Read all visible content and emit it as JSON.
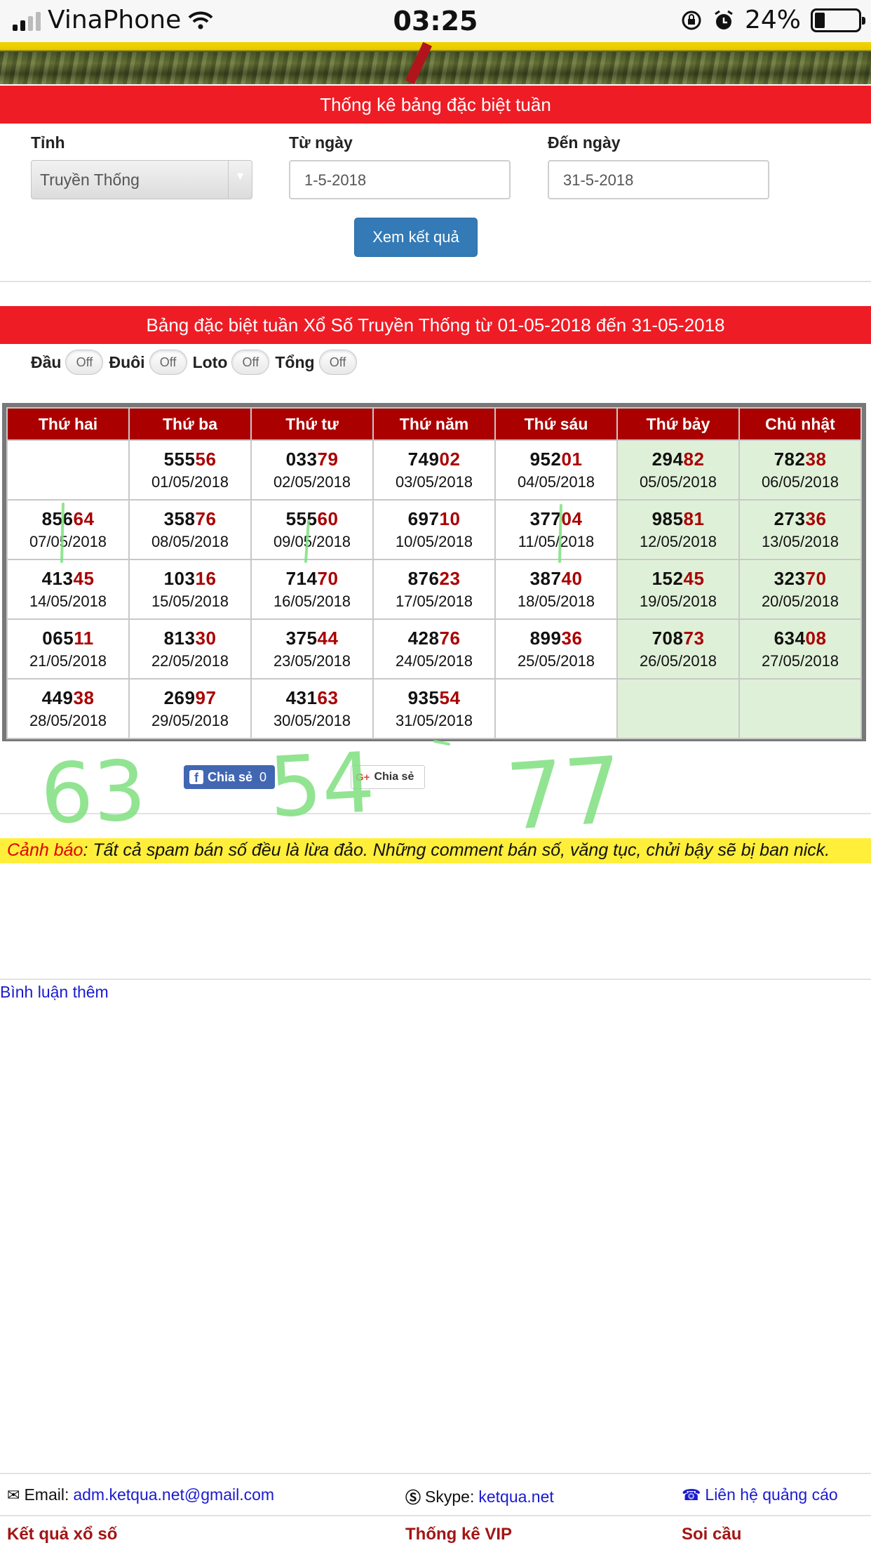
{
  "status_bar": {
    "carrier": "VinaPhone",
    "time": "03:25",
    "battery": "24%",
    "battery_level": 0.24
  },
  "stats_form": {
    "title": "Thống kê bảng đặc biệt tuần",
    "province_label": "Tỉnh",
    "province_value": "Truyền Thống",
    "from_label": "Từ ngày",
    "from_value": "1-5-2018",
    "to_label": "Đến ngày",
    "to_value": "31-5-2018",
    "submit_label": "Xem kết quả"
  },
  "results": {
    "title": "Bảng đặc biệt tuần Xổ Số Truyền Thống từ 01-05-2018 đến 31-05-2018",
    "toggles": [
      {
        "label": "Đầu",
        "state": "Off"
      },
      {
        "label": "Đuôi",
        "state": "Off"
      },
      {
        "label": "Loto",
        "state": "Off"
      },
      {
        "label": "Tổng",
        "state": "Off"
      }
    ],
    "columns": [
      "Thứ hai",
      "Thứ ba",
      "Thứ tư",
      "Thứ năm",
      "Thứ sáu",
      "Thứ bảy",
      "Chủ nhật"
    ],
    "rows": [
      [
        null,
        {
          "head": "555",
          "tail": "56",
          "date": "01/05/2018"
        },
        {
          "head": "033",
          "tail": "79",
          "date": "02/05/2018"
        },
        {
          "head": "749",
          "tail": "02",
          "date": "03/05/2018"
        },
        {
          "head": "952",
          "tail": "01",
          "date": "04/05/2018"
        },
        {
          "head": "294",
          "tail": "82",
          "date": "05/05/2018"
        },
        {
          "head": "782",
          "tail": "38",
          "date": "06/05/2018"
        }
      ],
      [
        {
          "head": "856",
          "tail": "64",
          "date": "07/05/2018"
        },
        {
          "head": "358",
          "tail": "76",
          "date": "08/05/2018"
        },
        {
          "head": "555",
          "tail": "60",
          "date": "09/05/2018"
        },
        {
          "head": "697",
          "tail": "10",
          "date": "10/05/2018"
        },
        {
          "head": "377",
          "tail": "04",
          "date": "11/05/2018"
        },
        {
          "head": "985",
          "tail": "81",
          "date": "12/05/2018"
        },
        {
          "head": "273",
          "tail": "36",
          "date": "13/05/2018"
        }
      ],
      [
        {
          "head": "413",
          "tail": "45",
          "date": "14/05/2018"
        },
        {
          "head": "103",
          "tail": "16",
          "date": "15/05/2018"
        },
        {
          "head": "714",
          "tail": "70",
          "date": "16/05/2018"
        },
        {
          "head": "876",
          "tail": "23",
          "date": "17/05/2018"
        },
        {
          "head": "387",
          "tail": "40",
          "date": "18/05/2018"
        },
        {
          "head": "152",
          "tail": "45",
          "date": "19/05/2018"
        },
        {
          "head": "323",
          "tail": "70",
          "date": "20/05/2018"
        }
      ],
      [
        {
          "head": "065",
          "tail": "11",
          "date": "21/05/2018"
        },
        {
          "head": "813",
          "tail": "30",
          "date": "22/05/2018"
        },
        {
          "head": "375",
          "tail": "44",
          "date": "23/05/2018"
        },
        {
          "head": "428",
          "tail": "76",
          "date": "24/05/2018"
        },
        {
          "head": "899",
          "tail": "36",
          "date": "25/05/2018"
        },
        {
          "head": "708",
          "tail": "73",
          "date": "26/05/2018"
        },
        {
          "head": "634",
          "tail": "08",
          "date": "27/05/2018"
        }
      ],
      [
        {
          "head": "449",
          "tail": "38",
          "date": "28/05/2018"
        },
        {
          "head": "269",
          "tail": "97",
          "date": "29/05/2018"
        },
        {
          "head": "431",
          "tail": "63",
          "date": "30/05/2018"
        },
        {
          "head": "935",
          "tail": "54",
          "date": "31/05/2018"
        },
        null,
        null,
        null
      ]
    ]
  },
  "share": {
    "facebook_label": "Chia sẻ",
    "facebook_count": "0",
    "google_label": "Chia sẻ"
  },
  "warning": {
    "prefix": "Cảnh báo",
    "text": ": Tất cả spam bán số đều là lừa đảo. Những comment bán số, văng tục, chửi bậy sẽ bị ban nick."
  },
  "comments": {
    "more_label": "Bình luận thêm"
  },
  "footer": {
    "email_label": "Email:",
    "email_value": "adm.ketqua.net@gmail.com",
    "skype_label": "Skype:",
    "skype_value": "ketqua.net",
    "ads_label": "Liên hệ quảng cáo",
    "nav": [
      "Kết quả xổ số",
      "Thống kê VIP",
      "Soi cầu"
    ]
  },
  "handwriting": [
    "63",
    "54",
    "77"
  ],
  "colors": {
    "header_red": "#ee1c25",
    "table_header": "#aa0000",
    "tail_red": "#aa0000",
    "weekend_green": "#dff0d8",
    "primary_blue": "#337ab7",
    "warning_yellow": "#ffef3b",
    "scribble_green": "#7fe07f"
  }
}
